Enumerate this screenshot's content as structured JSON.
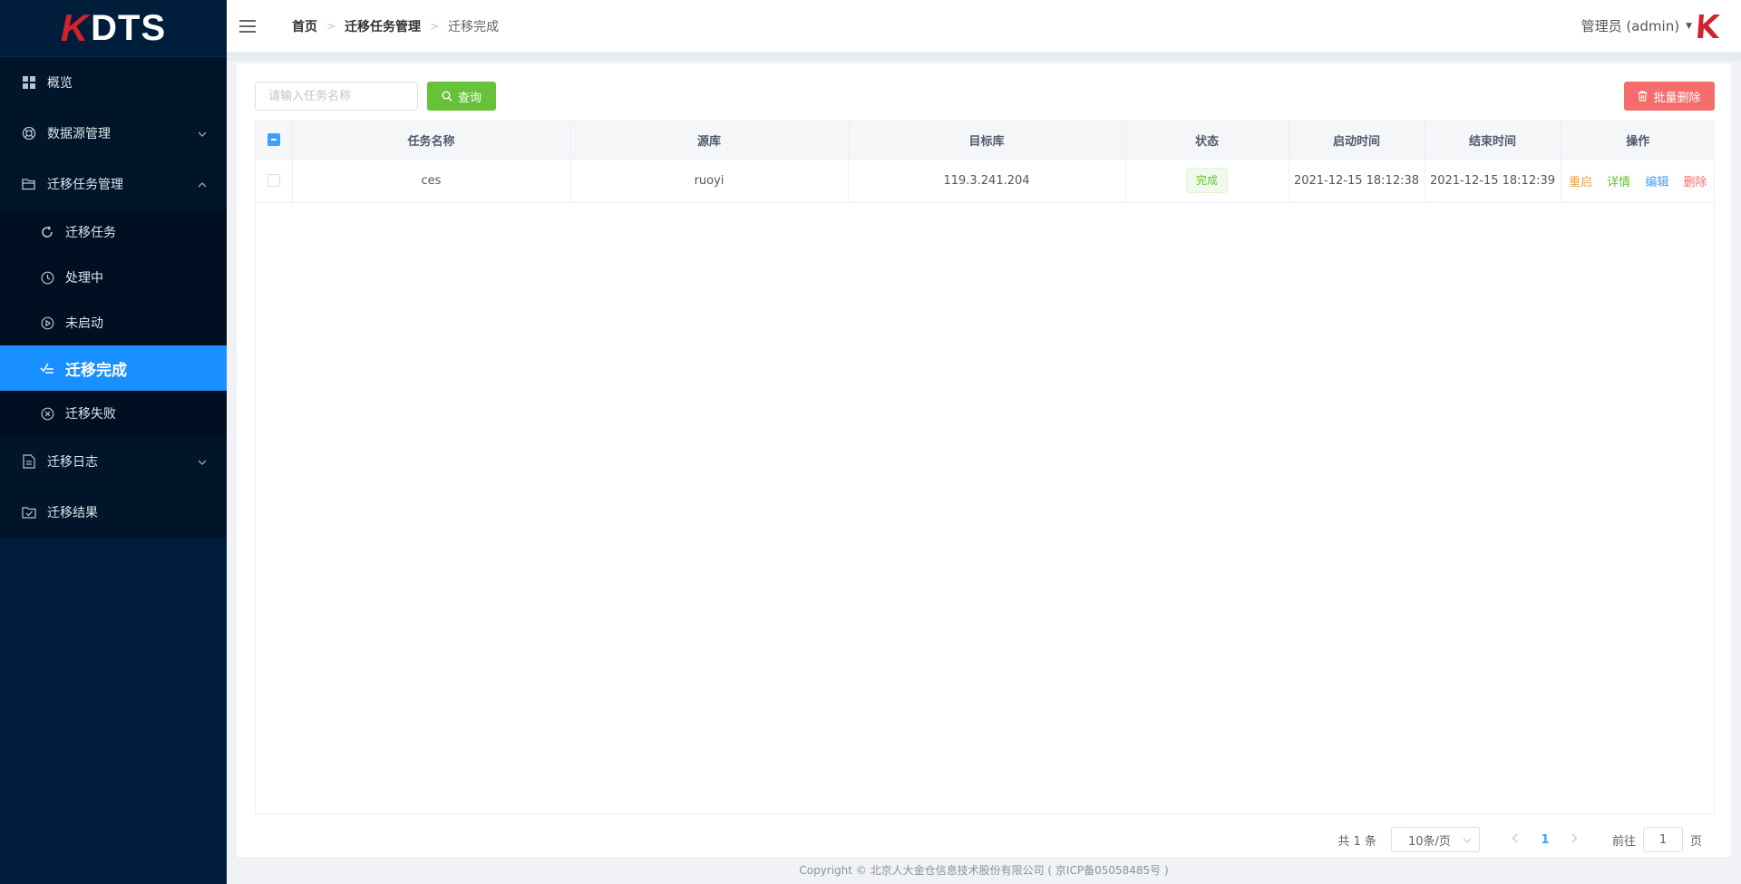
{
  "app": {
    "logo_k": "K",
    "logo_text": "DTS"
  },
  "sidebar": {
    "items": [
      {
        "label": "概览"
      },
      {
        "label": "数据源管理"
      },
      {
        "label": "迁移任务管理"
      },
      {
        "label": "迁移日志"
      },
      {
        "label": "迁移结果"
      }
    ],
    "subitems": [
      {
        "label": "迁移任务"
      },
      {
        "label": "处理中"
      },
      {
        "label": "未启动"
      },
      {
        "label": "迁移完成"
      },
      {
        "label": "迁移失败"
      }
    ]
  },
  "header": {
    "breadcrumb": [
      "首页",
      "迁移任务管理",
      "迁移完成"
    ],
    "user": "管理员 (admin)"
  },
  "toolbar": {
    "search_placeholder": "请输入任务名称",
    "query_label": "查询",
    "batch_delete_label": "批量删除"
  },
  "table": {
    "columns": [
      "任务名称",
      "源库",
      "目标库",
      "状态",
      "启动时间",
      "结束时间",
      "操作"
    ],
    "rows": [
      {
        "name": "ces",
        "source": "ruoyi",
        "target": "119.3.241.204",
        "status": "完成",
        "start_time": "2021-12-15 18:12:38",
        "end_time": "2021-12-15 18:12:39",
        "actions": [
          "重启",
          "详情",
          "编辑",
          "删除"
        ]
      }
    ]
  },
  "pagination": {
    "total_text": "共 1 条",
    "page_size": "10条/页",
    "current_page": "1",
    "goto_prefix": "前往",
    "goto_value": "1",
    "goto_suffix": "页"
  },
  "footer": {
    "copyright": "Copyright © 北京人大金仓信息技术股份有限公司 ( 京ICP备05058485号 )"
  },
  "colors": {
    "sidebar_bg": "#001e3c",
    "active_bg": "#1890ff",
    "query_green": "#67c23a",
    "delete_red": "#f56c6c",
    "restart": "#e6a23c",
    "detail": "#67c23a",
    "edit": "#409eff",
    "remove": "#f56c6c"
  }
}
